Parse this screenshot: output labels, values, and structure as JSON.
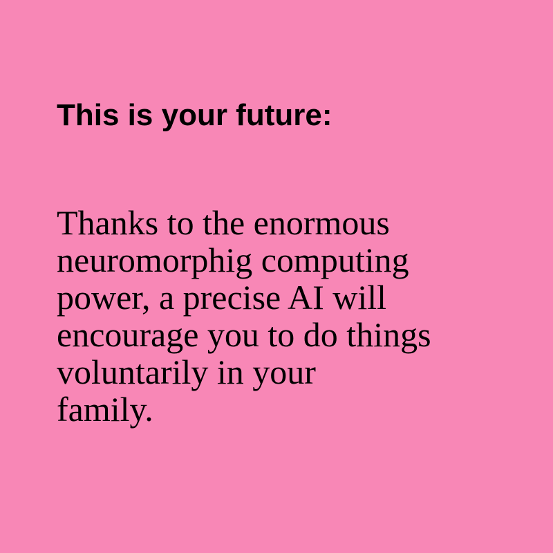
{
  "background_color": "#f887b6",
  "text_color": "#000000",
  "heading": "This is your future:",
  "body_lines": [
    "Thanks to the enormous",
    "neuromorphig computing",
    "power, a precise AI will",
    "encourage you to do things",
    "voluntarily in your",
    "family."
  ]
}
